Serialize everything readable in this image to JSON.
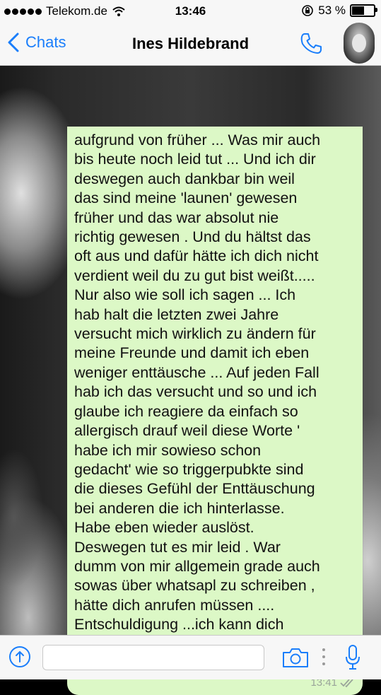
{
  "status_bar": {
    "carrier": "Telekom.de",
    "time": "13:46",
    "battery": "53 %",
    "battery_level": 0.53
  },
  "header": {
    "back_label": "Chats",
    "contact_name": "Ines Hildebrand"
  },
  "message": {
    "text": "aufgrund von früher ... Was mir auch\nbis heute noch leid tut ... Und ich dir\ndeswegen auch dankbar bin weil\ndas sind meine 'launen' gewesen\nfrüher und das war absolut nie\nrichtig gewesen . Und du hältst das\noft aus und dafür hätte ich dich nicht\nverdient weil du zu gut bist weißt.....\nNur also wie soll ich sagen ... Ich\nhab halt die letzten zwei Jahre\nversucht mich wirklich zu ändern für\nmeine Freunde und damit ich eben\nweniger enttäusche ... Auf jeden Fall\nhab ich das versucht und so und ich\nglaube ich reagiere da einfach so\nallergisch drauf weil diese Worte '\nhabe ich mir sowieso schon\ngedacht' wie so triggerpubkte sind\ndie dieses Gefühl der Enttäuschung\nbei anderen die ich hinterlasse.\nHabe eben wieder auslöst.\nDeswegen tut es mir leid . War\ndumm von mir allgemein grade auch\nsowas über whatsapl zu schreiben ,\nhätte dich anrufen müssen ....\nEntschuldigung ...ich kann dich\nnachvollziehen",
    "time": "13:41",
    "status_icon": "double-check-icon"
  },
  "input_bar": {
    "placeholder": ""
  },
  "colors": {
    "accent": "#1a7efb",
    "bubble": "#dcf8c6"
  }
}
